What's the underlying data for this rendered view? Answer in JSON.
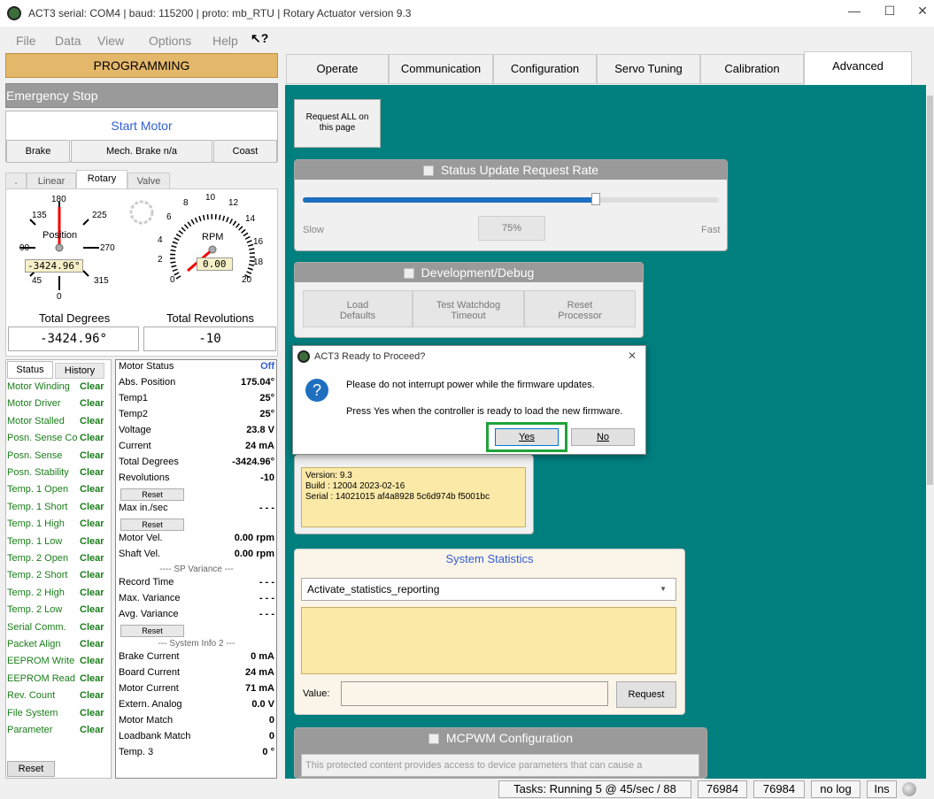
{
  "window": {
    "title": "ACT3  serial: COM4 | baud: 115200 | proto: mb_RTU | Rotary Actuator version 9.3",
    "minimize": "—",
    "maximize": "☐",
    "close": "✕"
  },
  "menu": {
    "items": [
      "File",
      "Data",
      "View",
      "Options",
      "Help"
    ]
  },
  "left": {
    "programming": "PROGRAMMING",
    "estop": "Emergency Stop",
    "start": "Start Motor",
    "brake": "Brake",
    "mech_brake": "Mech. Brake n/a",
    "coast": "Coast",
    "gauge_tabs": [
      ".",
      "Linear",
      "Rotary",
      "Valve"
    ],
    "position_gauge": {
      "label": "Position",
      "ticks": [
        "180",
        "135",
        "225",
        "90",
        "270",
        "45",
        "315",
        "0"
      ],
      "value": "-3424.96°"
    },
    "rpm_gauge": {
      "label": "RPM",
      "ticks": [
        "8",
        "10",
        "12",
        "6",
        "14",
        "4",
        "16",
        "2",
        "18",
        "0",
        "20"
      ],
      "value": "0.00"
    },
    "total_degrees_label": "Total Degrees",
    "total_revs_label": "Total Revolutions",
    "total_degrees": "-3424.96°",
    "total_revs": "-10"
  },
  "status_tabs": [
    "Status",
    "History"
  ],
  "status_items": [
    {
      "n": "Motor Winding",
      "v": "Clear"
    },
    {
      "n": "Motor Driver",
      "v": "Clear"
    },
    {
      "n": "Motor Stalled",
      "v": "Clear"
    },
    {
      "n": "Posn. Sense Co",
      "v": "Clear"
    },
    {
      "n": "Posn. Sense",
      "v": "Clear"
    },
    {
      "n": "Posn. Stability",
      "v": "Clear"
    },
    {
      "n": "Temp. 1 Open",
      "v": "Clear"
    },
    {
      "n": "Temp. 1 Short",
      "v": "Clear"
    },
    {
      "n": "Temp. 1 High",
      "v": "Clear"
    },
    {
      "n": "Temp. 1 Low",
      "v": "Clear"
    },
    {
      "n": "Temp. 2 Open",
      "v": "Clear"
    },
    {
      "n": "Temp. 2 Short",
      "v": "Clear"
    },
    {
      "n": "Temp. 2 High",
      "v": "Clear"
    },
    {
      "n": "Temp. 2 Low",
      "v": "Clear"
    },
    {
      "n": "Serial Comm.",
      "v": "Clear"
    },
    {
      "n": "Packet Align",
      "v": "Clear"
    },
    {
      "n": "EEPROM Write",
      "v": "Clear"
    },
    {
      "n": "EEPROM Read",
      "v": "Clear"
    },
    {
      "n": "Rev. Count",
      "v": "Clear"
    },
    {
      "n": "File System",
      "v": "Clear"
    },
    {
      "n": "Parameter",
      "v": "Clear"
    }
  ],
  "status_reset": "Reset",
  "motor_status": {
    "title": "Motor Status",
    "title_value": "Off",
    "rows": [
      {
        "n": "Abs. Position",
        "v": "175.04°"
      },
      {
        "n": "Temp1",
        "v": "25°"
      },
      {
        "n": "Temp2",
        "v": "25°"
      },
      {
        "n": "Voltage",
        "v": "23.8 V"
      },
      {
        "n": "Current",
        "v": "24 mA"
      },
      {
        "n": "Total Degrees",
        "v": "-3424.96°"
      },
      {
        "n": "Revolutions",
        "v": "-10"
      },
      {
        "n": "Max in./sec",
        "v": "- - -"
      },
      {
        "n": "Motor Vel.",
        "v": "0.00 rpm"
      },
      {
        "n": "Shaft Vel.",
        "v": "0.00 rpm"
      },
      {
        "n": "Record Time",
        "v": "- - -"
      },
      {
        "n": "Max. Variance",
        "v": "- - -"
      },
      {
        "n": "Avg. Variance",
        "v": "- - -"
      },
      {
        "n": "Brake Current",
        "v": "0 mA"
      },
      {
        "n": "Board Current",
        "v": "24 mA"
      },
      {
        "n": "Motor Current",
        "v": "71 mA"
      },
      {
        "n": "Extern. Analog",
        "v": "0.0 V"
      },
      {
        "n": "Motor Match",
        "v": "0"
      },
      {
        "n": "Loadbank Match",
        "v": "0"
      },
      {
        "n": "Temp. 3",
        "v": "0 °"
      }
    ],
    "reset": "Reset",
    "sp_variance": "---- SP Variance ---",
    "system_info": "--- System Info 2 ---"
  },
  "tabs": [
    "Operate",
    "Communication",
    "Configuration",
    "Servo Tuning",
    "Calibration",
    "Advanced"
  ],
  "advanced": {
    "request_all": "Request ALL on this page",
    "status_rate": {
      "title": "Status Update Request Rate",
      "slow": "Slow",
      "fast": "Fast",
      "value": "75%",
      "level": 0.75
    },
    "dev_debug": {
      "title": "Development/Debug",
      "load": "Load Defaults",
      "watchdog": "Test Watchdog Timeout",
      "reset": "Reset Processor"
    },
    "version": {
      "line1": "Version: 9.3",
      "line2": "Build  : 12004 2023-02-16",
      "line3": "Serial : 14021015 af4a8928 5c6d974b f5001bc"
    },
    "stats": {
      "title": "System Statistics",
      "select": "Activate_statistics_reporting",
      "value_label": "Value:",
      "request": "Request"
    },
    "mcpwm": {
      "title": "MCPWM Configuration",
      "note": "This protected content provides access to device parameters that can cause a"
    }
  },
  "dialog": {
    "title": "ACT3 Ready to Proceed?",
    "line1": "Please do not interrupt power while the firmware updates.",
    "line2": "Press Yes when the controller is ready to load the new firmware.",
    "yes": "Yes",
    "no": "No",
    "close": "✕"
  },
  "statusbar": {
    "tasks": "Tasks: Running 5 @ 45/sec / 88",
    "a": "76984",
    "b": "76984",
    "log": "no log",
    "ins": "Ins"
  },
  "colors": {
    "teal": "#007f7f",
    "accent": "#2f5fd0",
    "highlight": "#1fa33a",
    "ok": "#1a7d1a"
  }
}
